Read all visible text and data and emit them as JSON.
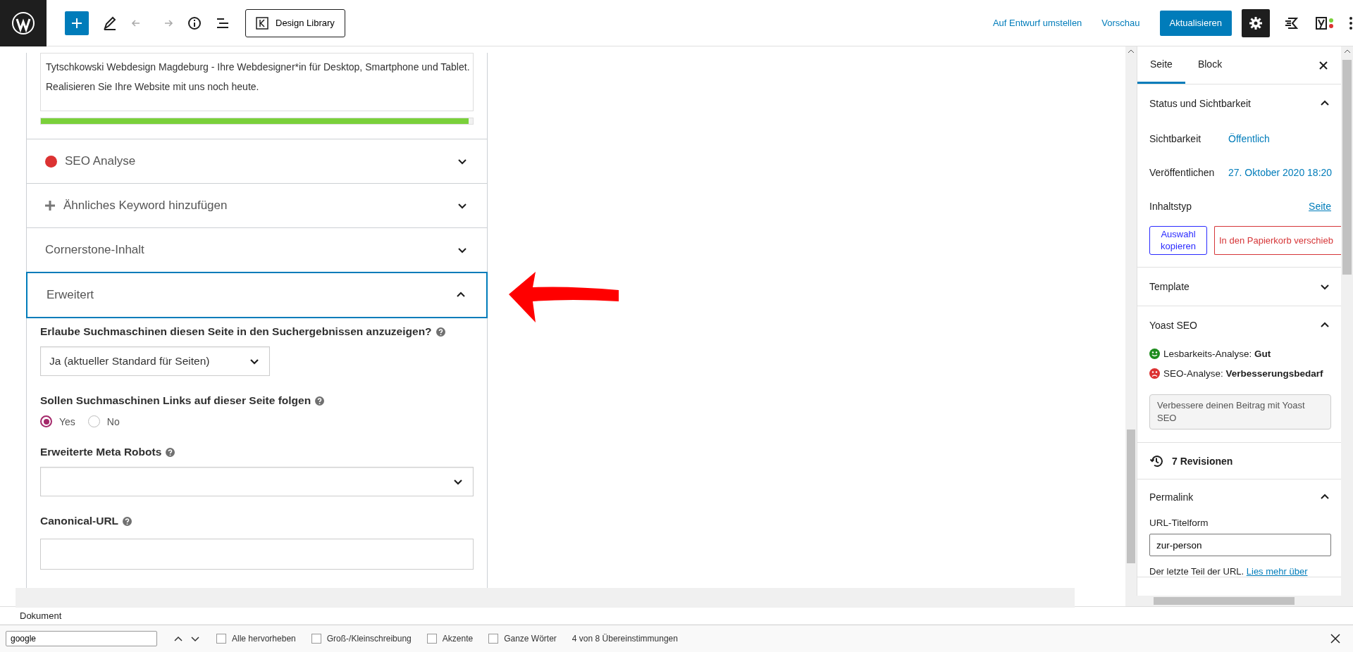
{
  "toolbar": {
    "design_library": "Design Library",
    "switch_to_draft": "Auf Entwurf umstellen",
    "preview": "Vorschau",
    "update": "Aktualisieren",
    "settings_active": true
  },
  "yoast_box": {
    "description": "Tytschkowski Webdesign Magdeburg - Ihre Webdesigner*in für Desktop, Smartphone und Tablet. Realisieren Sie Ihre Website mit uns noch heute.",
    "description_length": {
      "level": 0.99
    },
    "sections": [
      {
        "title": "SEO Analyse",
        "kind": "score",
        "color": "#dc3232",
        "expanded": false
      },
      {
        "title": "Ähnliches Keyword hinzufügen",
        "kind": "add",
        "expanded": false
      },
      {
        "title": "Cornerstone-Inhalt",
        "kind": "plain",
        "expanded": false
      },
      {
        "title": "Erweitert",
        "kind": "plain",
        "expanded": true
      }
    ],
    "advanced": {
      "index_label": "Erlaube Suchmaschinen diesen Seite in den Suchergebnissen anzuzeigen?",
      "index_value": "Ja (aktueller Standard für Seiten)",
      "follow_label": "Sollen Suchmaschinen Links auf dieser Seite folgen",
      "follow_options": [
        {
          "label": "Yes",
          "selected": true
        },
        {
          "label": "No",
          "selected": false
        }
      ],
      "meta_robots_label": "Erweiterte Meta Robots",
      "canonical_label": "Canonical-URL"
    }
  },
  "sidebar": {
    "tabs": [
      {
        "label": "Seite",
        "selected": true
      },
      {
        "label": "Block",
        "selected": false
      }
    ],
    "status": {
      "title": "Status und Sichtbarkeit",
      "expanded": true,
      "rows": [
        {
          "label": "Sichtbarkeit",
          "value": "Öffentlich",
          "kind": "plain"
        },
        {
          "label": "Veröffentlichen",
          "value": "27. Oktober 2020 18:20",
          "kind": "plain"
        },
        {
          "label": "Inhaltstyp",
          "value": "Seite",
          "kind": "link"
        }
      ],
      "copy_button": "Auswahl kopieren",
      "trash_button": "In den Papierkorb verschieb"
    },
    "template": {
      "title": "Template",
      "expanded": false
    },
    "yoast": {
      "title": "Yoast SEO",
      "expanded": true,
      "scores": [
        {
          "text": "Lesbarkeits-Analyse: **Gut**",
          "kind": "good",
          "color": "#1e8c1e"
        },
        {
          "text": "SEO-Analyse: **Verbesserungsbedarf**",
          "kind": "bad",
          "color": "#dc3232"
        }
      ],
      "improve_button": "Verbessere deinen Beitrag mit Yoast SEO"
    },
    "revisions": "7 Revisionen",
    "permalink": {
      "title": "Permalink",
      "expanded": true,
      "slug_label": "URL-Titelform",
      "slug": "zur-person",
      "help": "Der letzte Teil der URL.",
      "help_link": "Lies mehr über"
    }
  },
  "breadcrumb": "Dokument",
  "find_bar": {
    "query": "google",
    "options": [
      {
        "label": "Alle hervorheben",
        "checked": false
      },
      {
        "label": "Groß-/Kleinschreibung",
        "checked": false
      },
      {
        "label": "Akzente",
        "checked": false
      },
      {
        "label": "Ganze Wörter",
        "checked": false
      }
    ],
    "result": "4 von 8 Übereinstimmungen"
  }
}
